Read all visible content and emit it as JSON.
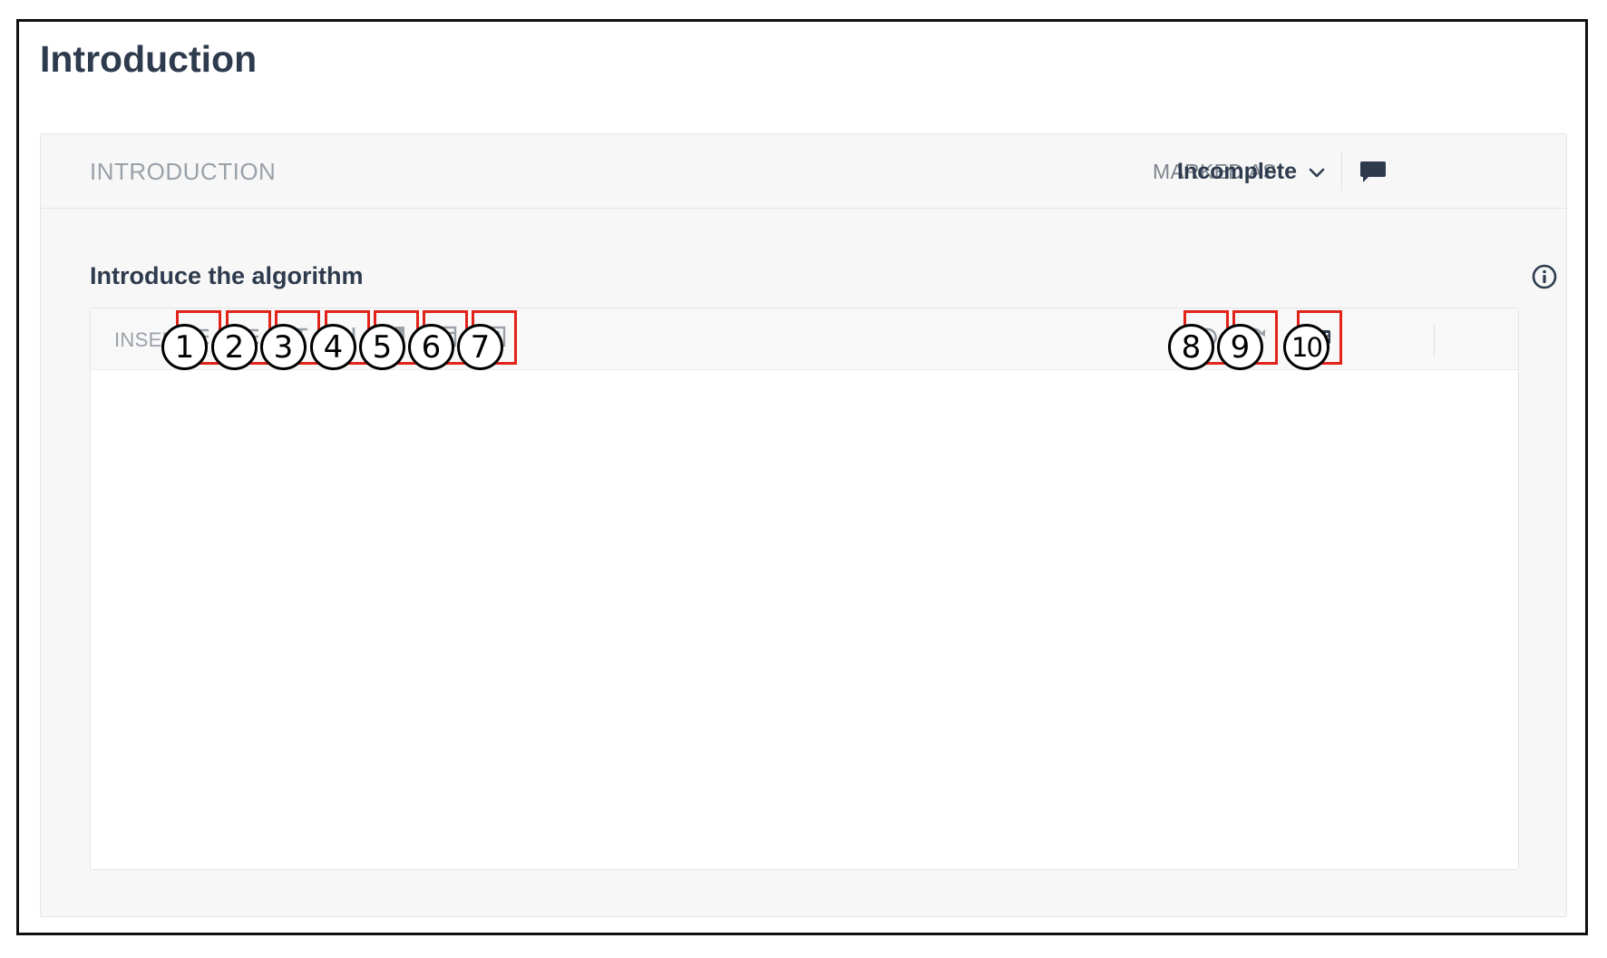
{
  "page": {
    "title": "Introduction"
  },
  "card": {
    "header_title": "INTRODUCTION",
    "marked_label": "MARKED AS",
    "status": "Incomplete",
    "comment_icon": "comment-icon"
  },
  "field": {
    "label": "Introduce the algorithm",
    "info_icon": "info-icon"
  },
  "editor": {
    "insert_label": "INSERT",
    "value": "",
    "toolbar": [
      {
        "icon": "bulleted-list-icon"
      },
      {
        "icon": "numbered-list-icon"
      },
      {
        "icon": "math-pi-icon"
      },
      {
        "icon": "heading-icon"
      },
      {
        "icon": "citation-book-icon"
      },
      {
        "icon": "table-icon"
      },
      {
        "icon": "image-icon"
      },
      {
        "icon": "undo-icon"
      },
      {
        "icon": "redo-icon"
      },
      {
        "icon": "keyboard-icon"
      }
    ]
  },
  "callouts": [
    "1",
    "2",
    "3",
    "4",
    "5",
    "6",
    "7",
    "8",
    "9",
    "10"
  ],
  "colors": {
    "highlight": "#e2231a",
    "title_text": "#2e3b4e",
    "muted_text": "#9aa1a9",
    "icon_gray": "#9aa1a9",
    "icon_dark": "#2e3b4e",
    "panel_bg": "#f7f7f7"
  }
}
